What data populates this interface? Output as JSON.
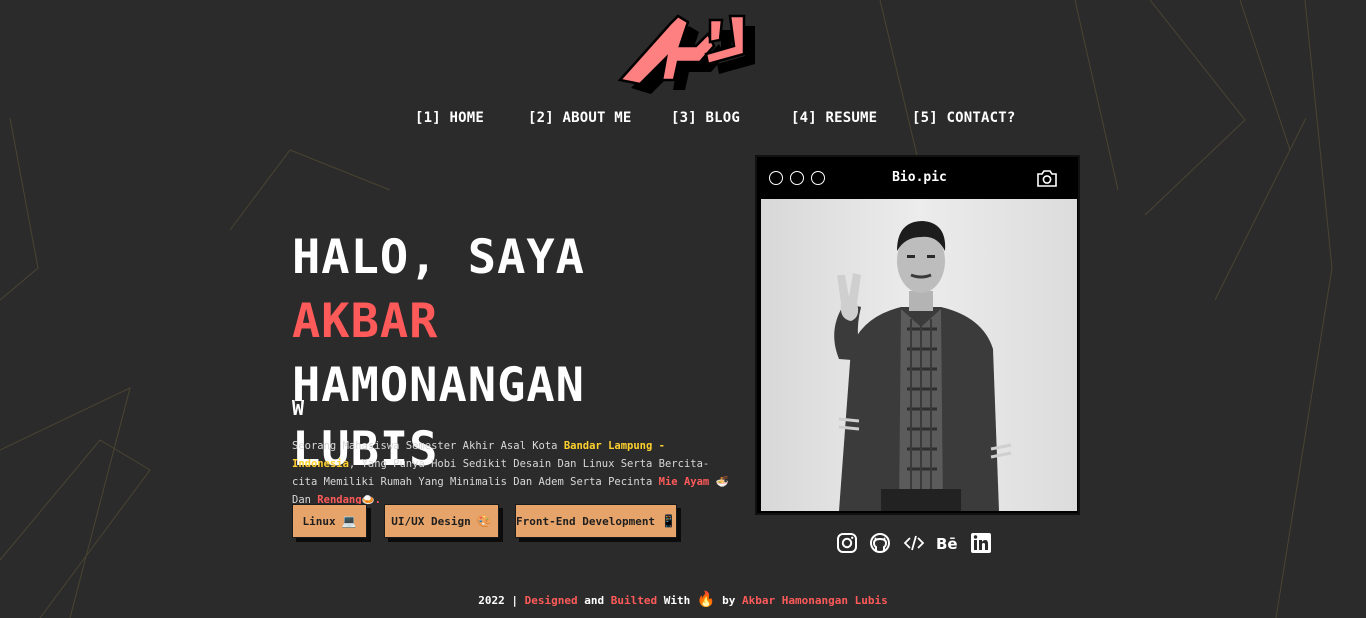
{
  "nav": {
    "items": [
      {
        "label": "[1] HOME"
      },
      {
        "label": "[2] ABOUT ME"
      },
      {
        "label": "[3] BLOG"
      },
      {
        "label": "[4] RESUME"
      },
      {
        "label": "[5] CONTACT?"
      }
    ]
  },
  "hero": {
    "title_prefix": "HALO, SAYA",
    "title_accent": "AKBAR",
    "title_line2": "HAMONANGAN LUBIS",
    "typed_text": "W",
    "bio": {
      "part1": "Seorang Mahasiswa Semester Akhir Asal Kota ",
      "city": "Bandar Lampung - Indonesia",
      "part2": ", Yang Punya Hobi Sedikit Desain Dan Linux Serta Bercita-cita Memiliki Rumah Yang Minimalis Dan Adem Serta Pecinta ",
      "food1": "Mie Ayam",
      "food1_icon": "🍜",
      "part3": " Dan ",
      "food2": "Rendang",
      "food2_icon": "🍛",
      "end": "."
    }
  },
  "chips": [
    {
      "label": "Linux",
      "icon": "💻"
    },
    {
      "label": "UI/UX Design",
      "icon": "🎨"
    },
    {
      "label": "Front-End Development",
      "icon": "📱"
    }
  ],
  "bio_window": {
    "title": "Bio.pic",
    "icon": "camera-icon"
  },
  "socials": [
    {
      "icon": "instagram-icon"
    },
    {
      "icon": "github-icon"
    },
    {
      "icon": "code-icon"
    },
    {
      "icon": "behance-icon"
    },
    {
      "icon": "linkedin-icon"
    }
  ],
  "footer": {
    "year": "2022 |",
    "designed": "Designed",
    "and": "and",
    "builted": "Builted",
    "with": "With",
    "fire": "🔥",
    "by": "by",
    "author": "Akbar Hamonangan Lubis"
  },
  "colors": {
    "background": "#2b2b2b",
    "accent": "#ff5a5a",
    "highlight": "#ffd12e",
    "chip": "#e7a46a",
    "logo": "#ff8080"
  }
}
